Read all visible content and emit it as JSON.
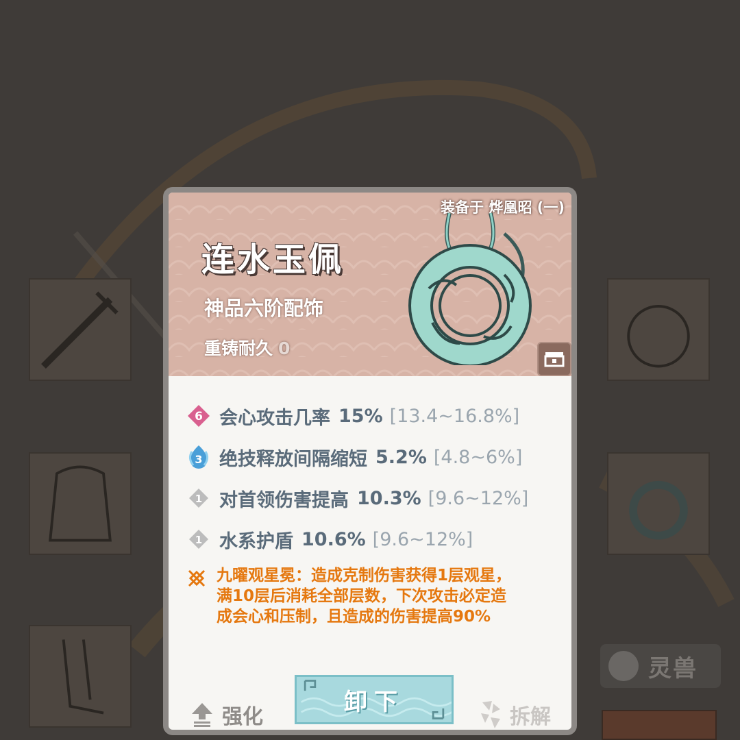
{
  "card": {
    "equipped_label": "装备于 烨凰昭 (一)",
    "name": "连水玉佩",
    "type": "神品六阶配饰",
    "durability_label": "重铸耐久",
    "durability_value": "0"
  },
  "stats": [
    {
      "badge": "6",
      "badge_color": "#d9608f",
      "label": "会心攻击几率",
      "value": "15%",
      "range": "[13.4~16.8%]"
    },
    {
      "badge": "3",
      "badge_color": "#4a9fd8",
      "label": "绝技释放间隔缩短",
      "value": "5.2%",
      "range": "[4.8~6%]"
    },
    {
      "badge": "1",
      "badge_color": "#b9b9b9",
      "label": "对首领伤害提高",
      "value": "10.3%",
      "range": "[9.6~12%]"
    },
    {
      "badge": "1",
      "badge_color": "#b9b9b9",
      "label": "水系护盾",
      "value": "10.6%",
      "range": "[9.6~12%]"
    }
  ],
  "special": {
    "icon": "star-orbit-icon",
    "lines": [
      "九曜观星冕：造成克制伤害获得1层观星，",
      "满10层后消耗全部层数，下次攻击必定造",
      "成会心和压制，且造成的伤害提高90%"
    ],
    "color": "#e5780f"
  },
  "buttons": {
    "enhance": "强化",
    "unequip": "卸下",
    "dismantle": "拆解"
  },
  "background": {
    "spirit_beast_label": "灵兽"
  }
}
